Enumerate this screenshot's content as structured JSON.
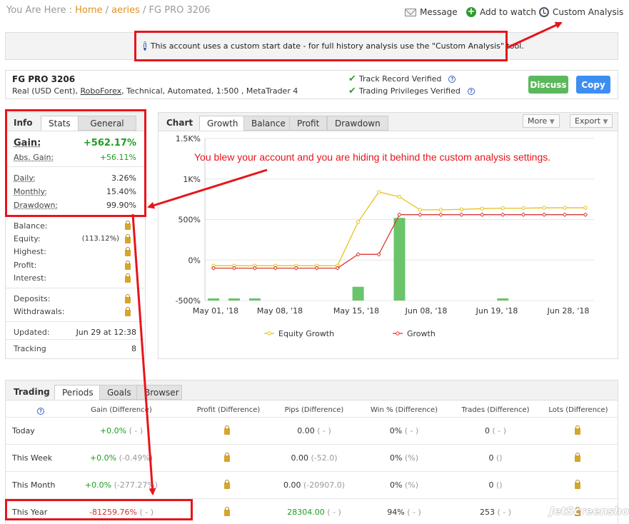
{
  "breadcrumb": {
    "prefix": "You Are Here :",
    "home": "Home",
    "sep1": "/",
    "crumb": "aeries",
    "sep2": "/",
    "current": "FG PRO 3206"
  },
  "top_actions": {
    "message": "Message",
    "watch": "Add to watch",
    "custom": "Custom Analysis"
  },
  "notice": {
    "text": "This account uses a custom start date - for full history analysis use the \"Custom Analysis\" tool."
  },
  "account": {
    "name": "FG PRO 3206",
    "desc_prefix": "Real (USD Cent),",
    "broker": "RoboForex",
    "desc_suffix": ", Technical, Automated, 1:500 , MetaTrader 4",
    "verified1": "Track Record Verified",
    "verified2": "Trading Privileges Verified",
    "discuss": "Discuss",
    "copy": "Copy"
  },
  "info": {
    "tabs": [
      "Info",
      "Stats",
      "General"
    ],
    "gain_label": "Gain:",
    "gain_value": "+562.17%",
    "abs_label": "Abs. Gain:",
    "abs_value": "+56.11%",
    "daily_label": "Daily:",
    "daily_value": "3.26%",
    "monthly_label": "Monthly:",
    "monthly_value": "15.40%",
    "drawdown_label": "Drawdown:",
    "drawdown_value": "99.90%",
    "balance_label": "Balance:",
    "equity_label": "Equity:",
    "equity_value": "(113.12%)",
    "highest_label": "Highest:",
    "profit_label": "Profit:",
    "interest_label": "Interest:",
    "deposits_label": "Deposits:",
    "withdrawals_label": "Withdrawals:",
    "updated_label": "Updated:",
    "updated_value": "Jun 29 at 12:38",
    "tracking_label": "Tracking",
    "tracking_value": "8"
  },
  "chart_panel": {
    "title": "Chart",
    "tabs": [
      "Growth",
      "Balance",
      "Profit",
      "Drawdown"
    ],
    "more": "More",
    "export": "Export"
  },
  "chart_data": {
    "type": "line",
    "yticks": [
      "1.5K%",
      "1K%",
      "500%",
      "0%",
      "-500%"
    ],
    "yvalues": [
      1500,
      1000,
      500,
      0,
      -500
    ],
    "ylim": [
      -500,
      1500
    ],
    "xticks": [
      "May 01, '18",
      "May 08, '18",
      "May 15, '18",
      "Jun 08, '18",
      "Jun 19, '18",
      "Jun 28, '18"
    ],
    "grid": true,
    "legend": "bottom",
    "series": [
      {
        "name": "Equity Growth",
        "color": "#e6c21c",
        "values": [
          -70,
          -70,
          -70,
          -70,
          -70,
          -70,
          -70,
          470,
          840,
          780,
          620,
          620,
          625,
          635,
          640,
          640,
          645,
          645,
          645
        ]
      },
      {
        "name": "Growth",
        "color": "#d93a3a",
        "values": [
          -100,
          -100,
          -100,
          -100,
          -100,
          -100,
          -100,
          70,
          70,
          560,
          560,
          560,
          560,
          560,
          560,
          560,
          560,
          560,
          560
        ]
      }
    ],
    "bars": {
      "color": "#6ac46a",
      "values": [
        -485,
        -480,
        -475,
        0,
        0,
        0,
        0,
        -170,
        0,
        520,
        0,
        0,
        0,
        0,
        -480,
        0,
        0,
        0,
        0
      ]
    }
  },
  "annotation": {
    "text": "You blew your account and you are hiding it behind the custom analysis settings."
  },
  "trading": {
    "title": "Trading",
    "tabs": [
      "Periods",
      "Goals",
      "Browser"
    ],
    "headers": [
      "Gain (Difference)",
      "Profit (Difference)",
      "Pips (Difference)",
      "Win % (Difference)",
      "Trades (Difference)",
      "Lots (Difference)"
    ],
    "rows": [
      {
        "period": "Today",
        "gain": "+0.0%",
        "gain_diff": "( - )",
        "pips": "0.00",
        "pips_diff": "( - )",
        "win": "0%",
        "win_diff": "( - )",
        "trades": "0",
        "trades_diff": "( - )"
      },
      {
        "period": "This Week",
        "gain": "+0.0%",
        "gain_diff": "(-0.49%)",
        "pips": "0.00",
        "pips_diff": "(-52.0)",
        "win": "0%",
        "win_diff": "(%)",
        "trades": "0",
        "trades_diff": "()"
      },
      {
        "period": "This Month",
        "gain": "+0.0%",
        "gain_diff": "(-277.27%)",
        "pips": "0.00",
        "pips_diff": "(-20907.0)",
        "win": "0%",
        "win_diff": "(%)",
        "trades": "0",
        "trades_diff": "()"
      },
      {
        "period": "This Year",
        "gain": "-81259.76%",
        "gain_diff": "( - )",
        "pips": "28304.00",
        "pips_diff": "( - )",
        "win": "94%",
        "win_diff": "( - )",
        "trades": "253",
        "trades_diff": "( - )"
      }
    ]
  },
  "watermark": "JetScreenshot"
}
